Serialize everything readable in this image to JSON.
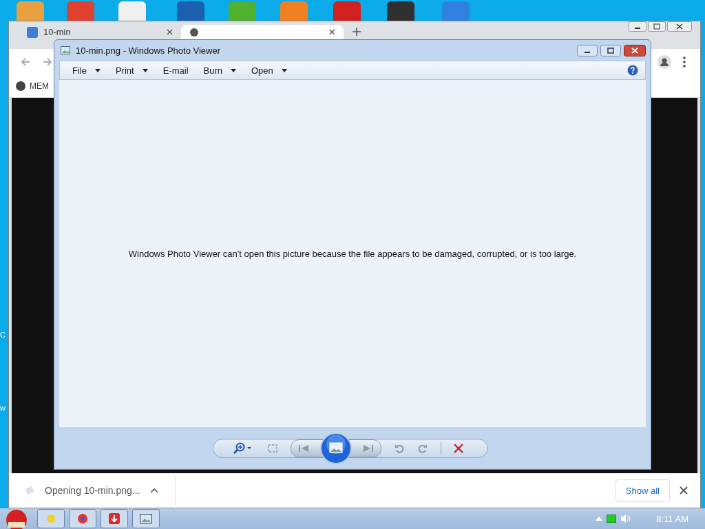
{
  "desktop": {
    "labels": [
      "C",
      "w"
    ]
  },
  "browser": {
    "tabs": [
      {
        "title": "10-min",
        "selected": false
      },
      {
        "selected": true
      }
    ],
    "bookmarks": [
      "MEM"
    ],
    "download_bar": {
      "item": "Opening 10-min.png...",
      "show_all": "Show all"
    }
  },
  "photo_viewer": {
    "title": "10-min.png - Windows Photo Viewer",
    "menu": [
      {
        "label": "File",
        "dropdown": true
      },
      {
        "label": "Print",
        "dropdown": true
      },
      {
        "label": "E-mail",
        "dropdown": false
      },
      {
        "label": "Burn",
        "dropdown": true
      },
      {
        "label": "Open",
        "dropdown": true
      }
    ],
    "message": "Windows Photo Viewer can't open this picture because the file appears to be damaged, corrupted, or is too large."
  },
  "taskbar": {
    "clock": "8:11 AM"
  }
}
